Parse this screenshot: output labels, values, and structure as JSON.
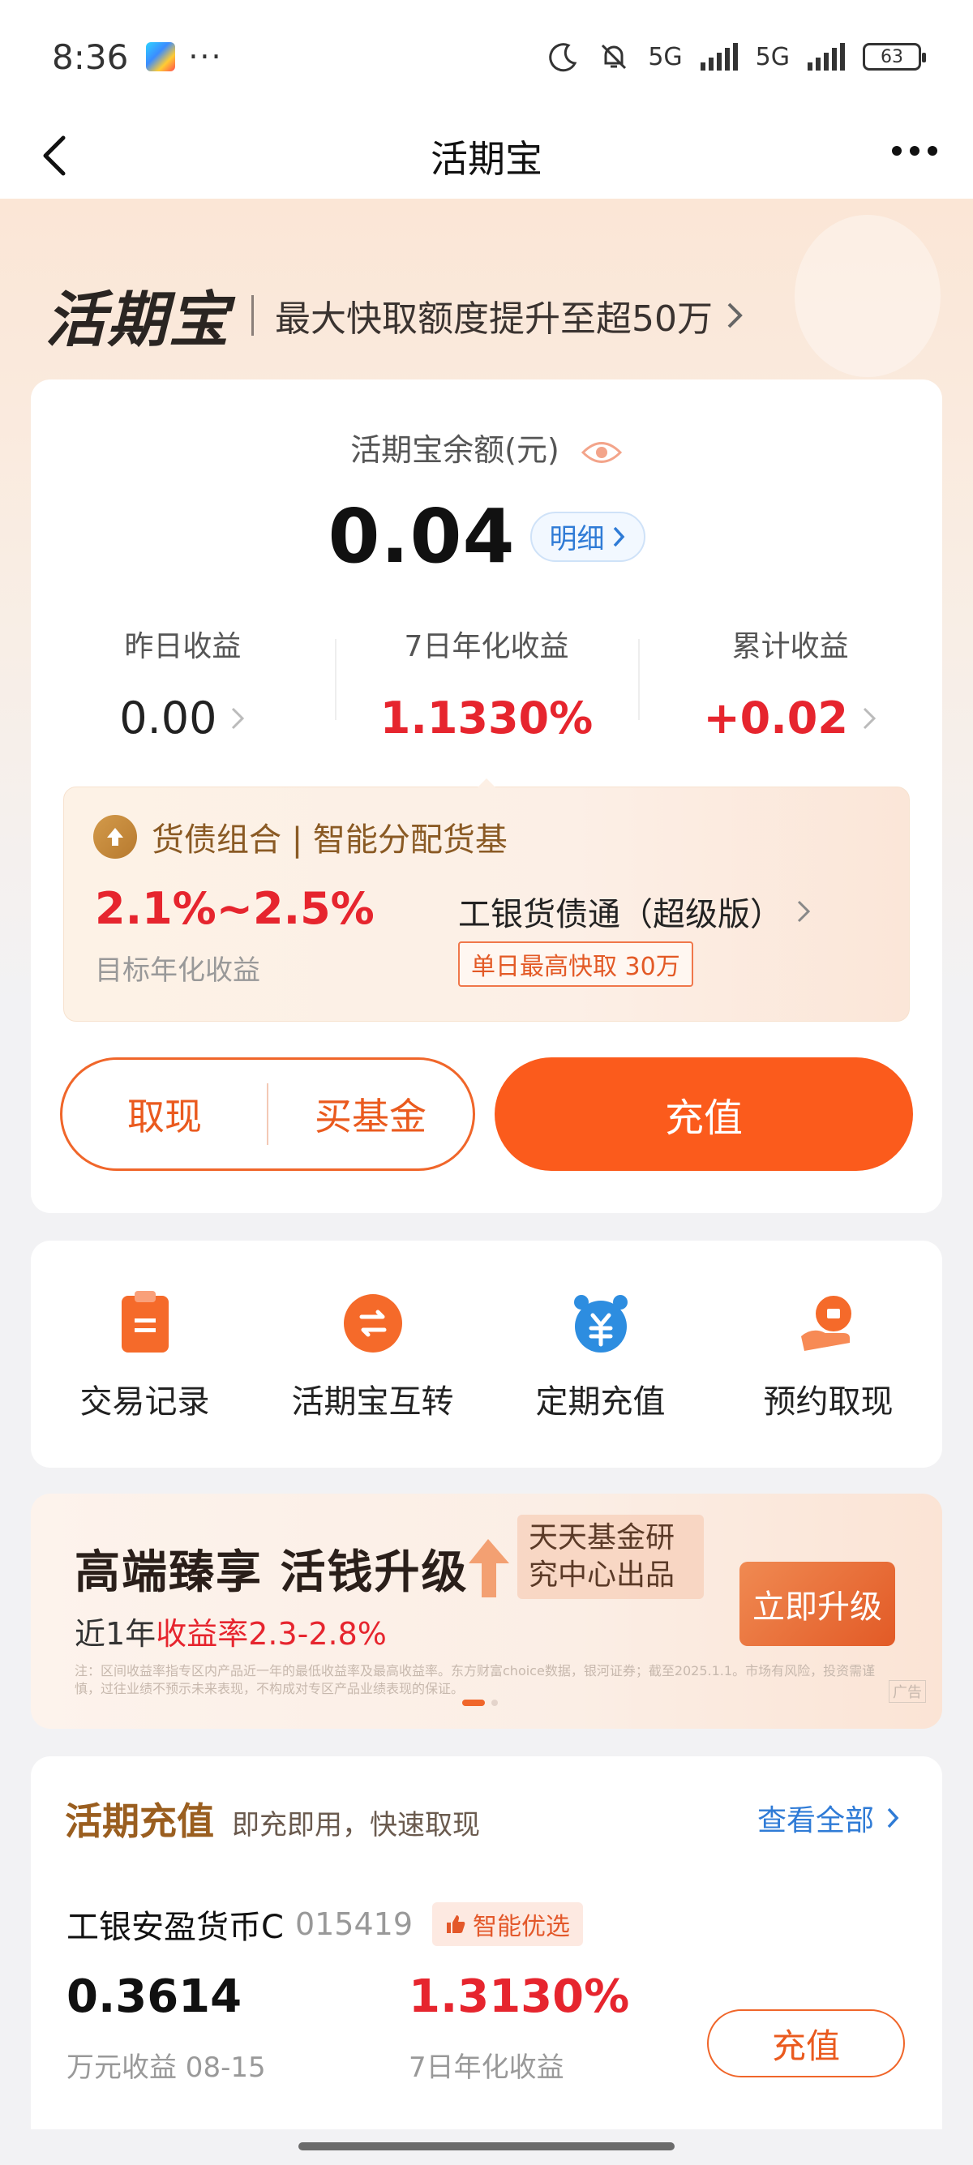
{
  "status_bar": {
    "time": "8:36",
    "more": "···",
    "network1": "5G",
    "network2": "5G",
    "battery": "63"
  },
  "nav": {
    "title": "活期宝"
  },
  "hero": {
    "logo": "活期宝",
    "slogan": "最大快取额度提升至超50万"
  },
  "balance": {
    "label": "活期宝余额(元)",
    "amount": "0.04",
    "detail_label": "明细",
    "stats": [
      {
        "label": "昨日收益",
        "value": "0.00"
      },
      {
        "label": "7日年化收益",
        "value": "1.1330%"
      },
      {
        "label": "累计收益",
        "value": "+0.02"
      }
    ]
  },
  "combo": {
    "title": "货债组合 | 智能分配货基",
    "rate": "2.1%~2.5%",
    "rate_label": "目标年化收益",
    "fund": "工银货债通（超级版）",
    "badge": "单日最高快取 30万"
  },
  "actions": {
    "withdraw": "取现",
    "buy_fund": "买基金",
    "charge": "充值"
  },
  "quick": [
    {
      "label": "交易记录",
      "icon": "document-icon"
    },
    {
      "label": "活期宝互转",
      "icon": "transfer-icon"
    },
    {
      "label": "定期充值",
      "icon": "alarm-clock-yuan-icon"
    },
    {
      "label": "预约取现",
      "icon": "hand-money-icon"
    }
  ],
  "promo": {
    "title": "高端臻享 活钱升级",
    "tag": "天天基金研究中心出品",
    "sub_prefix": "近1年",
    "sub_highlight": "收益率2.3-2.8%",
    "button": "立即升级",
    "note": "注：区间收益率指专区内产品近一年的最低收益率及最高收益率。东方财富choice数据，银河证券；截至2025.1.1。市场有风险，投资需谨慎，过往业绩不预示未来表现，不构成对专区产品业绩表现的保证。",
    "ad": "广告"
  },
  "fund_section": {
    "title": "活期充值",
    "subtitle": "即充即用，快速取现",
    "view_all": "查看全部",
    "fund": {
      "name": "工银安盈货币C",
      "code": "015419",
      "badge": "智能优选",
      "value1": "0.3614",
      "label1": "万元收益 08-15",
      "value2": "1.3130%",
      "label2": "7日年化收益",
      "button": "充值"
    }
  },
  "colors": {
    "accent": "#fb5b1c",
    "red": "#e6252e",
    "link": "#2f7bd6"
  }
}
